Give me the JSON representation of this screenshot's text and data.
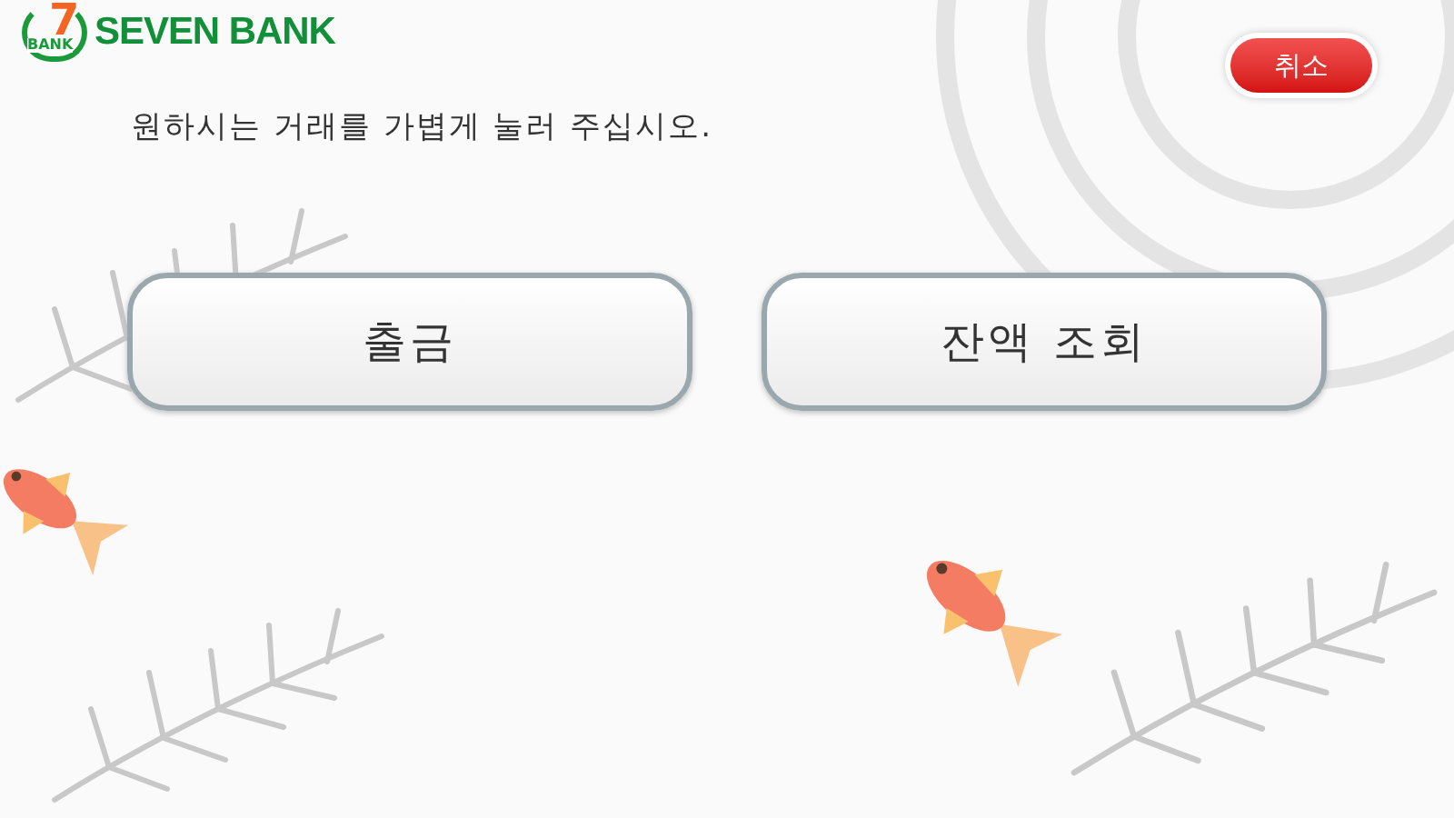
{
  "logo": {
    "mark_digit": "7",
    "mark_text": "BANK",
    "name": "SEVEN BANK"
  },
  "cancel_button": {
    "label": "취소"
  },
  "instruction": "원하시는 거래를 가볍게 눌러 주십시오.",
  "options": [
    {
      "label": "출금"
    },
    {
      "label": "잔액 조회"
    }
  ]
}
